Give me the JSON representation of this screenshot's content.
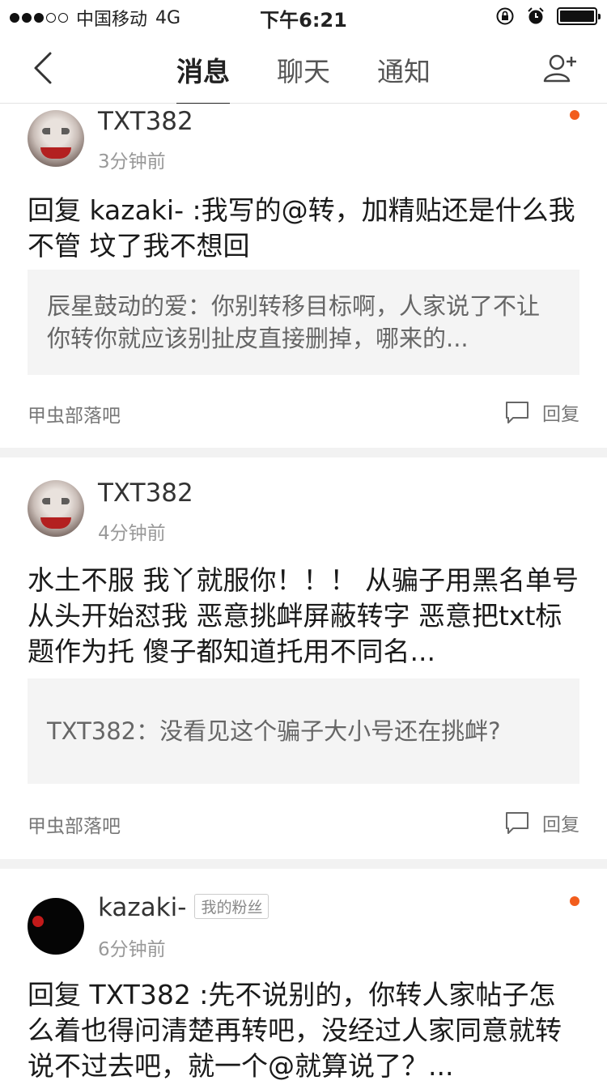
{
  "status_bar": {
    "carrier": "中国移动",
    "network": "4G",
    "time": "下午6:21",
    "signal_dots": [
      true,
      true,
      true,
      false,
      false
    ]
  },
  "nav": {
    "tabs": [
      "消息",
      "聊天",
      "通知"
    ],
    "active_tab": "消息"
  },
  "feed": [
    {
      "username": "TXT382",
      "time": "3分钟前",
      "body": "回复 kazaki- :我写的@转，加精贴还是什么我不管 坟了我不想回",
      "quote": "辰星鼓动的爱：你别转移目标啊，人家说了不让你转你就应该别扯皮直接删掉，哪来的...",
      "forum": "甲虫部落吧",
      "reply_label": "回复",
      "unread": true
    },
    {
      "username": "TXT382",
      "time": "4分钟前",
      "body": "水土不服 我丫就服你！！！ 从骗子用黑名单号从头开始怼我 恶意挑衅屏蔽转字 恶意把txt标题作为托 傻子都知道托用不同名...",
      "quote": "TXT382：没看见这个骗子大小号还在挑衅?",
      "forum": "甲虫部落吧",
      "reply_label": "回复",
      "unread": false
    },
    {
      "username": "kazaki-",
      "badge": "我的粉丝",
      "time": "6分钟前",
      "body": "回复 TXT382 :先不说别的，你转人家帖子怎么着也得问清楚再转吧，没经过人家同意就转说不过去吧，就一个@就算说了？...",
      "unread": true
    }
  ],
  "colors": {
    "unread_dot": "#f25d1d",
    "quote_bg": "#f4f4f4",
    "divider": "#f2f2f2"
  }
}
